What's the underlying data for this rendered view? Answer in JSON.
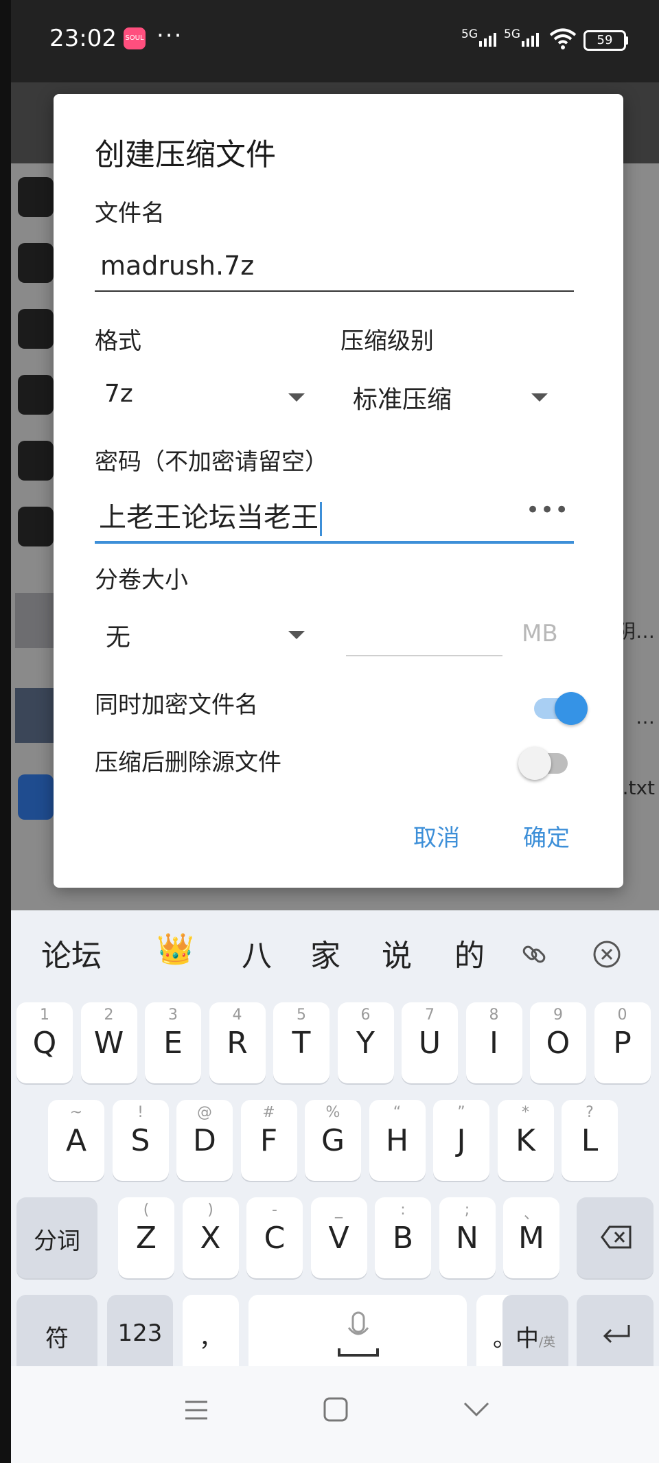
{
  "status_bar": {
    "time": "23:02",
    "app_badge": "SOUL",
    "more": "···",
    "sim1": "5G",
    "sim2": "5G",
    "battery": "59",
    "icons": [
      "app-notification-icon",
      "signal-icon",
      "signal-icon",
      "wifi-icon",
      "battery-icon"
    ]
  },
  "background": {
    "item_text_1": "阴…",
    "item_text_2": "…",
    "item_text_3": ".txt"
  },
  "dialog": {
    "title": "创建压缩文件",
    "filename_label": "文件名",
    "filename_value": "madrush.7z",
    "format_label": "格式",
    "format_value": "7z",
    "level_label": "压缩级别",
    "level_value": "标准压缩",
    "password_label": "密码（不加密请留空）",
    "password_value": "上老王论坛当老王",
    "password_toggle": "•••",
    "split_label": "分卷大小",
    "split_value": "无",
    "split_unit": "MB",
    "encrypt_names_label": "同时加密文件名",
    "encrypt_names_on": true,
    "delete_source_label": "压缩后删除源文件",
    "delete_source_on": false,
    "cancel_label": "取消",
    "ok_label": "确定",
    "accent_color": "#3d8fd8"
  },
  "keyboard": {
    "suggestions": [
      "论坛",
      "八",
      "家",
      "说",
      "的"
    ],
    "suggestion_icons": [
      "crown-emoji",
      "link-icon",
      "close-circle-icon"
    ],
    "crown": "👑",
    "row1": [
      {
        "hint": "1",
        "key": "Q"
      },
      {
        "hint": "2",
        "key": "W"
      },
      {
        "hint": "3",
        "key": "E"
      },
      {
        "hint": "4",
        "key": "R"
      },
      {
        "hint": "5",
        "key": "T"
      },
      {
        "hint": "6",
        "key": "Y"
      },
      {
        "hint": "7",
        "key": "U"
      },
      {
        "hint": "8",
        "key": "I"
      },
      {
        "hint": "9",
        "key": "O"
      },
      {
        "hint": "0",
        "key": "P"
      }
    ],
    "row2": [
      {
        "hint": "~",
        "key": "A"
      },
      {
        "hint": "!",
        "key": "S"
      },
      {
        "hint": "@",
        "key": "D"
      },
      {
        "hint": "#",
        "key": "F"
      },
      {
        "hint": "%",
        "key": "G"
      },
      {
        "hint": "“",
        "key": "H"
      },
      {
        "hint": "”",
        "key": "J"
      },
      {
        "hint": "*",
        "key": "K"
      },
      {
        "hint": "?",
        "key": "L"
      }
    ],
    "row3_left": "分词",
    "row3": [
      {
        "hint": "(",
        "key": "Z"
      },
      {
        "hint": ")",
        "key": "X"
      },
      {
        "hint": "-",
        "key": "C"
      },
      {
        "hint": "_",
        "key": "V"
      },
      {
        "hint": ":",
        "key": "B"
      },
      {
        "hint": ";",
        "key": "N"
      },
      {
        "hint": "、",
        "key": "M"
      }
    ],
    "row4": {
      "symbols": "符",
      "numbers": "123",
      "comma": "，",
      "period": "。",
      "lang_main": "中",
      "lang_sub": "/英"
    }
  },
  "nav_bar": {
    "icons": [
      "menu-icon",
      "home-square-icon",
      "back-chevron-icon"
    ]
  }
}
